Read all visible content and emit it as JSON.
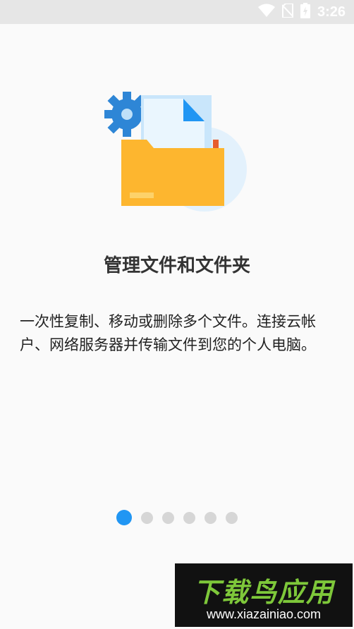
{
  "status_bar": {
    "time": "3:26",
    "icons": [
      "wifi-icon",
      "no-sim-icon",
      "battery-charging-icon"
    ]
  },
  "onboarding": {
    "illustration": "folder-with-documents-and-gear-icon",
    "title": "管理文件和文件夹",
    "description": "一次性复制、移动或删除多个文件。连接云帐户、网络服务器并传输文件到您的个人电脑。"
  },
  "pagination": {
    "total_pages": 6,
    "current_page": 1,
    "active_color": "#2196f3",
    "inactive_color": "#d6d6d6"
  },
  "watermark": {
    "title": "下载鸟应用",
    "url": "www.xiazainiao.com"
  }
}
